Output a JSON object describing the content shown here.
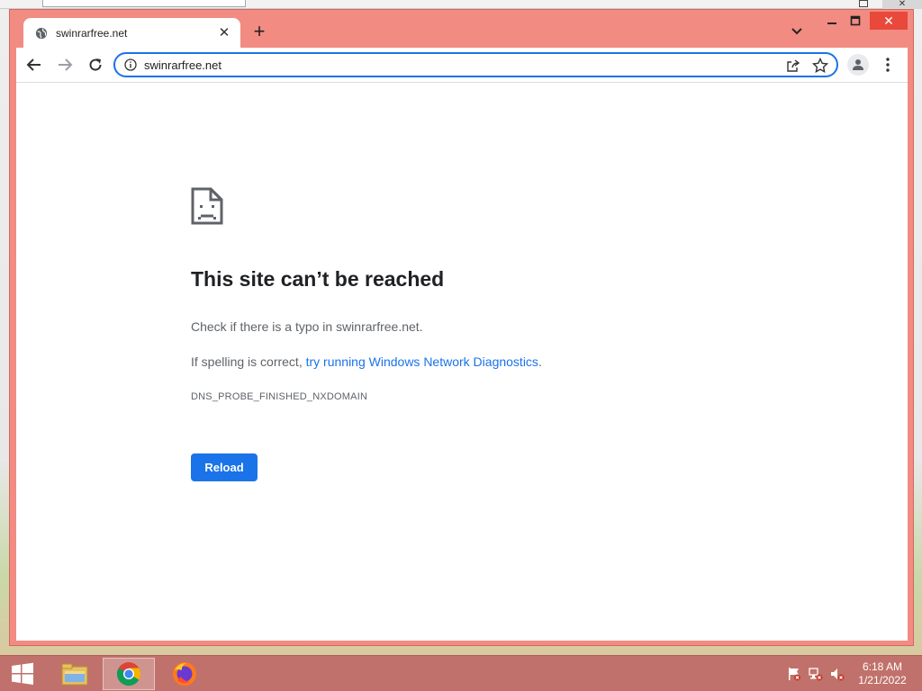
{
  "tab": {
    "title": "swinrarfree.net",
    "close_glyph": "✕",
    "new_tab_glyph": "+"
  },
  "window_controls": {
    "close_glyph": "✕"
  },
  "omnibox": {
    "url": "swinrarfree.net"
  },
  "error_page": {
    "title": "This site can’t be reached",
    "line1": "Check if there is a typo in swinrarfree.net.",
    "line2_prefix": "If spelling is correct, ",
    "line2_link": "try running Windows Network Diagnostics",
    "line2_suffix": ".",
    "error_code": "DNS_PROBE_FINISHED_NXDOMAIN",
    "reload_label": "Reload"
  },
  "taskbar": {
    "clock_time": "6:18 AM",
    "clock_date": "1/21/2022",
    "apps": [
      "file-explorer-icon",
      "chrome-icon",
      "firefox-icon"
    ]
  },
  "colors": {
    "frame": "#f28b82",
    "accent": "#1a73e8",
    "taskbar": "#c1716b"
  },
  "background_window": {
    "close_glyph": "✕"
  }
}
